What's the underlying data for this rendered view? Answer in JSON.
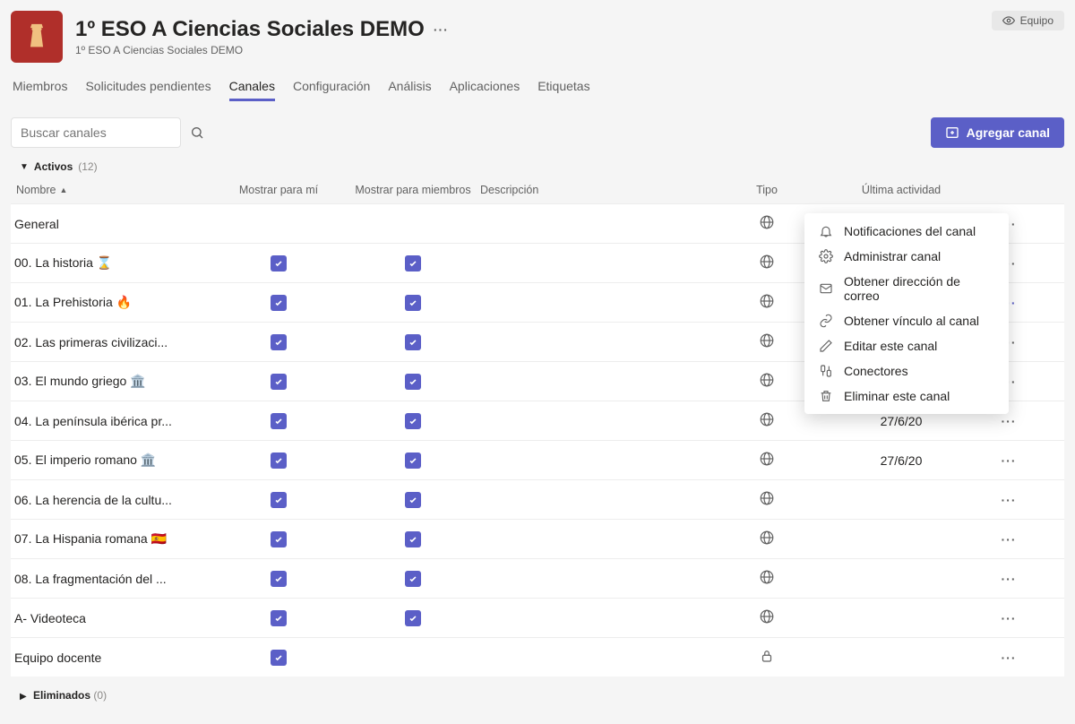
{
  "header": {
    "title": "1º ESO A Ciencias Sociales DEMO",
    "subtitle": "1º ESO A Ciencias Sociales DEMO",
    "team_button": "Equipo"
  },
  "tabs": [
    {
      "id": "miembros",
      "label": "Miembros"
    },
    {
      "id": "solicitudes",
      "label": "Solicitudes pendientes"
    },
    {
      "id": "canales",
      "label": "Canales"
    },
    {
      "id": "configuracion",
      "label": "Configuración"
    },
    {
      "id": "analisis",
      "label": "Análisis"
    },
    {
      "id": "aplicaciones",
      "label": "Aplicaciones"
    },
    {
      "id": "etiquetas",
      "label": "Etiquetas"
    }
  ],
  "active_tab": "canales",
  "search": {
    "placeholder": "Buscar canales"
  },
  "add_button": "Agregar canal",
  "section": {
    "label": "Activos",
    "count": "(12)"
  },
  "columns": {
    "name": "Nombre",
    "show_me": "Mostrar para mí",
    "show_members": "Mostrar para miembros",
    "description": "Descripción",
    "type": "Tipo",
    "last_activity": "Última actividad"
  },
  "rows": [
    {
      "name": "General",
      "show_me": false,
      "show_members": false,
      "type": "globe",
      "last": "",
      "more_active": false
    },
    {
      "name": "00. La historia ⌛",
      "show_me": true,
      "show_members": true,
      "type": "globe",
      "last": "",
      "more_active": false
    },
    {
      "name": "01. La Prehistoria 🔥",
      "show_me": true,
      "show_members": true,
      "type": "globe",
      "last": "",
      "more_active": true
    },
    {
      "name": "02. Las primeras civilizaci...",
      "show_me": true,
      "show_members": true,
      "type": "globe",
      "last": "",
      "more_active": false
    },
    {
      "name": "03. El mundo griego 🏛️",
      "show_me": true,
      "show_members": true,
      "type": "globe",
      "last": "",
      "more_active": false
    },
    {
      "name": "04. La península ibérica pr...",
      "show_me": true,
      "show_members": true,
      "type": "globe",
      "last": "27/6/20",
      "more_active": false
    },
    {
      "name": "05. El imperio romano 🏛️",
      "show_me": true,
      "show_members": true,
      "type": "globe",
      "last": "27/6/20",
      "more_active": false
    },
    {
      "name": "06. La herencia de la cultu...",
      "show_me": true,
      "show_members": true,
      "type": "globe",
      "last": "",
      "more_active": false
    },
    {
      "name": "07. La Hispania romana 🇪🇸",
      "show_me": true,
      "show_members": true,
      "type": "globe",
      "last": "",
      "more_active": false
    },
    {
      "name": "08. La fragmentación del ...",
      "show_me": true,
      "show_members": true,
      "type": "globe",
      "last": "",
      "more_active": false
    },
    {
      "name": "A- Videoteca",
      "show_me": true,
      "show_members": true,
      "type": "globe",
      "last": "",
      "more_active": false
    },
    {
      "name": "Equipo docente",
      "show_me": true,
      "show_members": false,
      "type": "lock",
      "last": "",
      "more_active": false
    }
  ],
  "eliminated": {
    "label": "Eliminados",
    "count": "(0)"
  },
  "menu": {
    "notifications": "Notificaciones del canal",
    "manage": "Administrar canal",
    "email": "Obtener dirección de correo",
    "link": "Obtener vínculo al canal",
    "edit": "Editar este canal",
    "connectors": "Conectores",
    "delete": "Eliminar este canal"
  }
}
